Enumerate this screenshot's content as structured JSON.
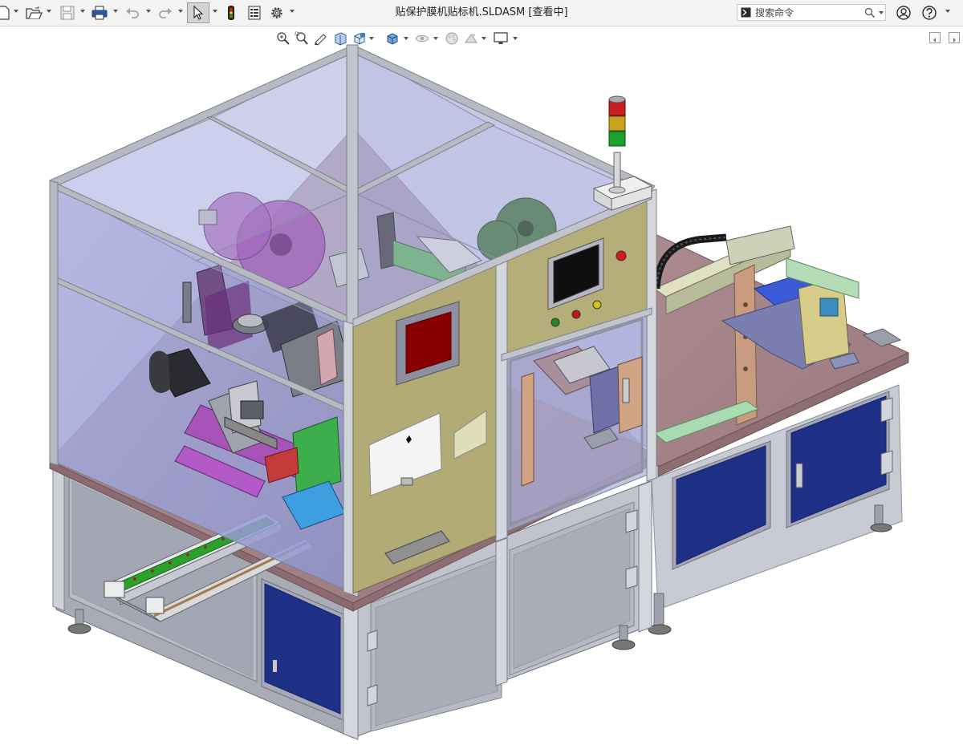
{
  "window": {
    "title": "贴保护膜机贴标机.SLDASM [查看中]"
  },
  "search": {
    "placeholder": "搜索命令"
  },
  "toolbar": {
    "items": [
      "new-icon",
      "open-icon",
      "save-icon",
      "print-icon",
      "undo-icon",
      "redo-icon",
      "select-icon",
      "rebuild-icon",
      "file-properties-icon",
      "options-icon"
    ]
  },
  "heads_up_toolbar": {
    "items": [
      "zoom-to-fit-icon",
      "zoom-to-area-icon",
      "previous-view-icon",
      "section-view-icon",
      "view-orientation-icon",
      "display-style-icon",
      "hide-show-items-icon",
      "edit-appearance-icon",
      "apply-scene-icon",
      "view-settings-icon"
    ]
  },
  "colors": {
    "titlebar_bg": "#f3f3f3",
    "frame_aluminum": "#a9acb5",
    "glass": "#9fa4d8",
    "panel_olive": "#b3ab76",
    "plate_brown": "#a7868a",
    "cabinet_door": "#1e2f86",
    "screen_red": "#8a0000"
  }
}
